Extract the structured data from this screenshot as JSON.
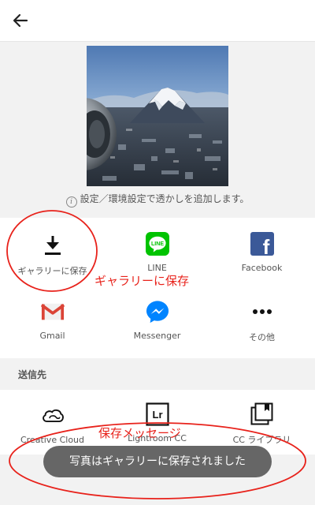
{
  "header": {
    "back_icon": "arrow-left-icon"
  },
  "preview": {
    "info_text": "設定／環境設定で透かしを追加します。",
    "info_icon": "info-icon"
  },
  "share_targets": [
    {
      "label": "ギャラリーに保存",
      "icon": "download-icon"
    },
    {
      "label": "LINE",
      "icon": "line-icon",
      "icon_text": "LINE",
      "color": "#00c300"
    },
    {
      "label": "Facebook",
      "icon": "facebook-icon",
      "icon_text": "f",
      "color": "#3b5998"
    },
    {
      "label": "Gmail",
      "icon": "gmail-icon",
      "color": "#db4437"
    },
    {
      "label": "Messenger",
      "icon": "messenger-icon",
      "color": "#0084ff"
    },
    {
      "label": "その他",
      "icon": "more-icon"
    }
  ],
  "destinations": {
    "section_label": "送信先",
    "items": [
      {
        "label": "Creative Cloud",
        "icon": "creative-cloud-icon"
      },
      {
        "label": "Lightroom CC",
        "icon": "lightroom-icon",
        "icon_text": "Lr"
      },
      {
        "label": "CC ライブラリ",
        "icon": "cc-library-icon"
      }
    ]
  },
  "annotations": {
    "gallery_note": "ギャラリーに保存",
    "toast_note": "保存メッセージ",
    "color": "#e8221b"
  },
  "toast": {
    "message": "写真はギャラリーに保存されました"
  }
}
